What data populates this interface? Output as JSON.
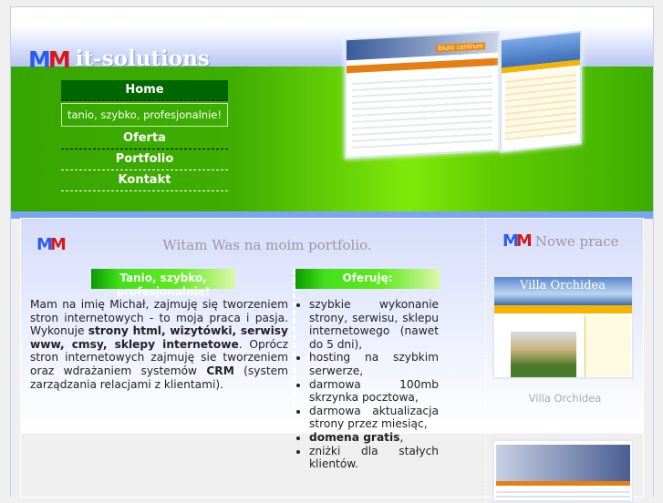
{
  "brand": {
    "logo_letters": "MM",
    "name": "it-solutions"
  },
  "nav": {
    "items": [
      "Home",
      "Oferta",
      "Portfolio",
      "Kontakt"
    ],
    "slogan": "tanio, szybko, profesjonalnie!"
  },
  "main": {
    "title": "Witam Was na moim portfolio.",
    "left_heading": "Tanio, szybko, profesjonalnie!",
    "intro": {
      "p1": "Mam na imię Michał, zajmuję się tworzeniem stron internetowych - to moja praca i pasja. Wykonuje ",
      "b1": "strony html, wizytówki, serwisy www, cmsy, sklepy internetowe",
      "p2": ". Oprócz stron internetowych zajmuję sie tworzeniem oraz wdrażaniem systemów ",
      "b2": "CRM",
      "p3": " (system zarządzania relacjami z klientami)."
    },
    "right_heading": "Oferuję:",
    "offer": [
      "szybkie wykonanie strony, serwisu, sklepu internetowego (nawet do 5 dni),",
      "hosting na szybkim serwerze,",
      "darmowa 100mb skrzynka pocztowa,",
      "darmowa aktualizacja strony przez miesiąc,",
      "domena gratis",
      ", ",
      "zniżki dla stałych klientów."
    ]
  },
  "sidebar": {
    "heading": "Nowe prace",
    "works": [
      {
        "caption": "Villa Orchidea",
        "thumb_title": "Villa Orchidea"
      },
      {
        "thumb_title": "biuro centrum"
      }
    ]
  },
  "colors": {
    "green": "#3fae00",
    "nav_active": "#006600",
    "accent_blue": "#2a5cf0",
    "accent_red": "#d21a1a"
  }
}
